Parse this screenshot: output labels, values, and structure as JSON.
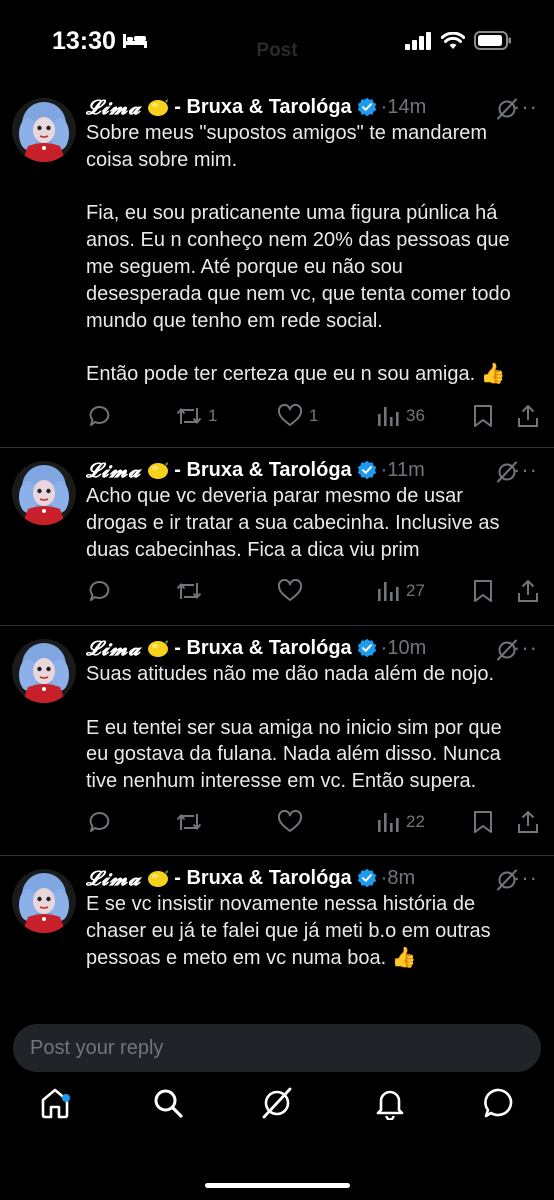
{
  "status_bar": {
    "time": "13:30"
  },
  "header": {
    "title": "Post"
  },
  "tweets": [
    {
      "author_script": "𝓛𝓲𝓶𝓪",
      "author_rest": " - Bruxa & Tarológa",
      "time": "14m",
      "text": "Sobre meus \"supostos amigos\" te mandarem\ncoisa sobre mim.\n\nFia, eu sou praticanente uma figura púnlica há\nanos. Eu n conheço nem 20% das pessoas que\nme seguem. Até porque eu não sou\ndesesperada que nem vc, que tenta comer todo\nmundo que tenho em rede social.\n\nEntão pode ter certeza que eu n sou amiga. 👍",
      "reposts": "1",
      "likes": "1",
      "views": "36"
    },
    {
      "author_script": "𝓛𝓲𝓶𝓪",
      "author_rest": " - Bruxa & Tarológa",
      "time": "11m",
      "text": "Acho que vc deveria parar mesmo de usar\ndrogas e ir tratar a sua cabecinha. Inclusive as\nduas cabecinhas. Fica a dica viu prim",
      "reposts": "",
      "likes": "",
      "views": "27"
    },
    {
      "author_script": "𝓛𝓲𝓶𝓪",
      "author_rest": " - Bruxa & Tarológa",
      "time": "10m",
      "text": "Suas atitudes não me dão nada além de nojo.\n\nE eu tentei ser sua amiga no inicio sim por que\neu gostava da fulana. Nada além disso. Nunca\ntive nenhum interesse em vc. Então supera.",
      "reposts": "",
      "likes": "",
      "views": "22"
    },
    {
      "author_script": "𝓛𝓲𝓶𝓪",
      "author_rest": " - Bruxa & Tarológa",
      "time": "8m",
      "text": "E se vc insistir novamente nessa história de\nchaser eu já te falei que já meti b.o em outras\npessoas e meto em vc numa boa. 👍",
      "reposts": "",
      "likes": "",
      "views": ""
    }
  ],
  "reply": {
    "placeholder": "Post your reply"
  },
  "colors": {
    "accent": "#1d9bf0",
    "muted": "#71767b",
    "text": "#e7e9ea",
    "background": "#000000"
  }
}
